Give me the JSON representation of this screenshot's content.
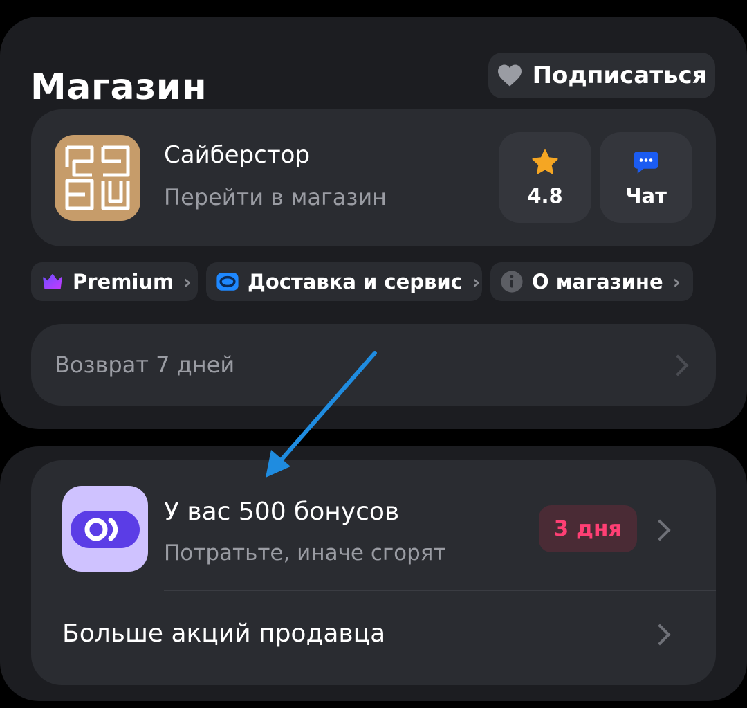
{
  "store_section": {
    "title": "Магазин",
    "subscribe_label": "Подписаться",
    "shop": {
      "name": "Сайберстор",
      "subtitle": "Перейти в магазин",
      "rating": "4.8",
      "chat_label": "Чат"
    },
    "chips": [
      {
        "label": "Premium",
        "icon": "crown-icon"
      },
      {
        "label": "Доставка и сервис",
        "icon": "delivery-icon"
      },
      {
        "label": "О магазине",
        "icon": "info-icon"
      }
    ],
    "return_policy": "Возврат 7 дней"
  },
  "promo_section": {
    "bonus_title": "У вас 500 бонусов",
    "bonus_subtitle": "Потратьте, иначе сгорят",
    "days_badge": "3 дня",
    "more_promos": "Больше акций продавца"
  },
  "colors": {
    "background": "#000000",
    "card": "#1c1d21",
    "inner": "#2a2c31",
    "accent_star": "#f5a623",
    "chat_blue": "#1b5cf2",
    "badge_text": "#ff3f74",
    "bonus_purple": "#5b3de6",
    "annotation_arrow": "#1f8ce0"
  }
}
